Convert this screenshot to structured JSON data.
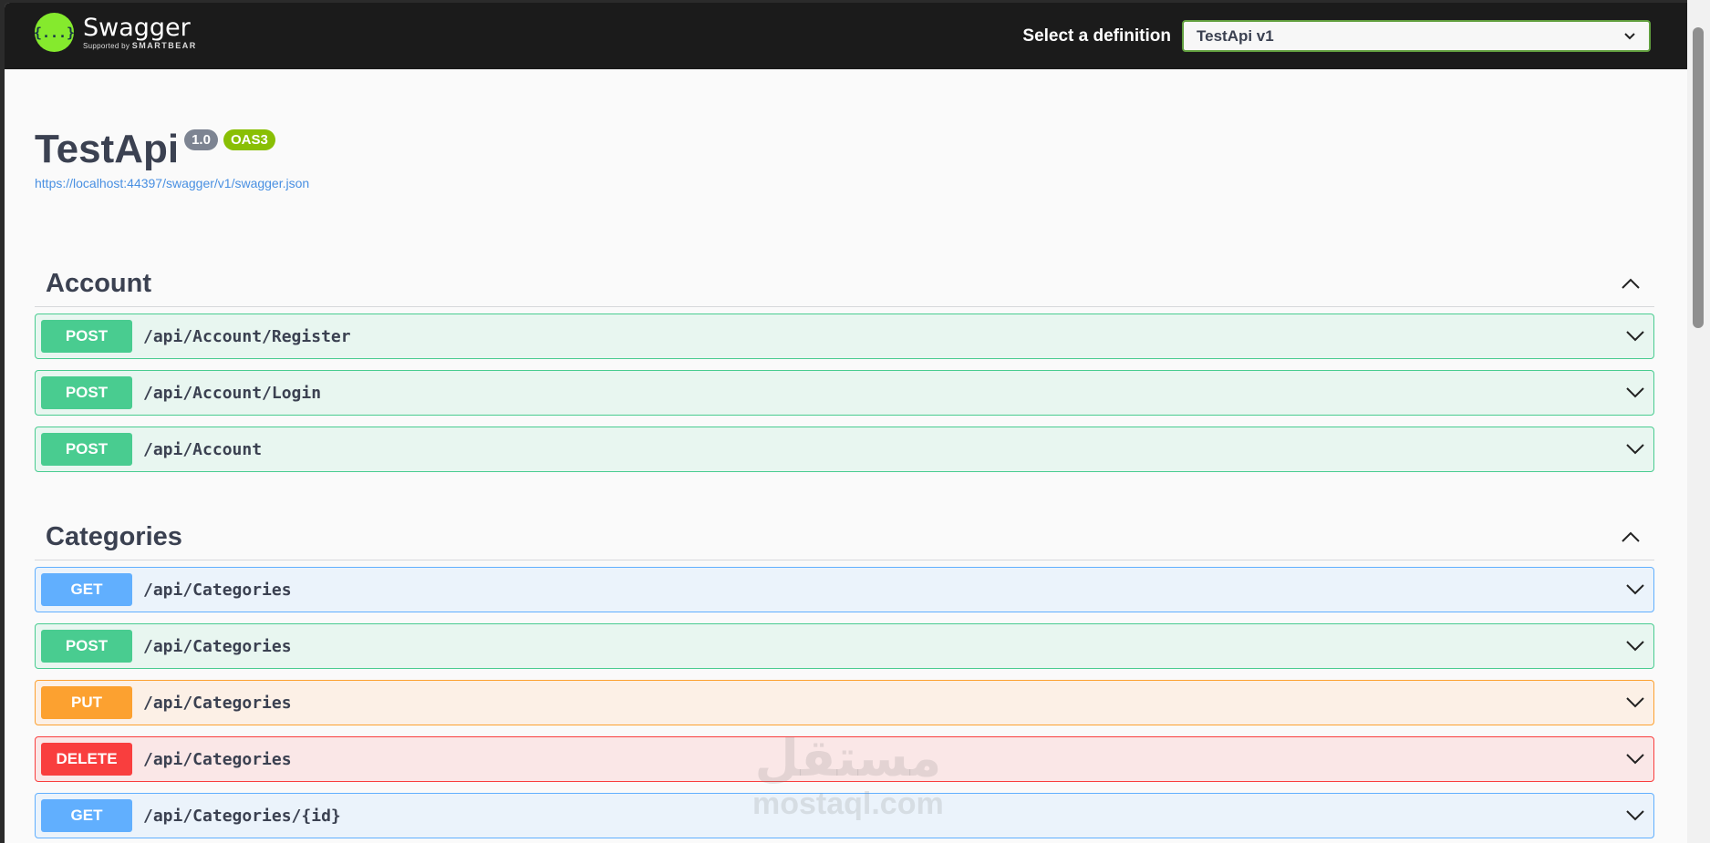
{
  "header": {
    "logo_icon": "{...}",
    "logo_name": "Swagger",
    "logo_supported": "Supported by",
    "logo_brand": "SMARTBEAR",
    "definition_label": "Select a definition",
    "definition_value": "TestApi v1"
  },
  "info": {
    "title": "TestApi",
    "version": "1.0",
    "oas": "OAS3",
    "url": "https://localhost:44397/swagger/v1/swagger.json"
  },
  "sections": [
    {
      "name": "Account",
      "ops": [
        {
          "method": "POST",
          "path": "/api/Account/Register"
        },
        {
          "method": "POST",
          "path": "/api/Account/Login"
        },
        {
          "method": "POST",
          "path": "/api/Account"
        }
      ]
    },
    {
      "name": "Categories",
      "ops": [
        {
          "method": "GET",
          "path": "/api/Categories"
        },
        {
          "method": "POST",
          "path": "/api/Categories"
        },
        {
          "method": "PUT",
          "path": "/api/Categories"
        },
        {
          "method": "DELETE",
          "path": "/api/Categories"
        },
        {
          "method": "GET",
          "path": "/api/Categories/{id}"
        }
      ]
    }
  ],
  "watermark": {
    "arabic": "مستقل",
    "latin": "mostaql.com"
  },
  "colors": {
    "post": "#49cc90",
    "get": "#61affe",
    "put": "#fca130",
    "delete": "#f93e3e",
    "topbar": "#1b1b1b"
  }
}
